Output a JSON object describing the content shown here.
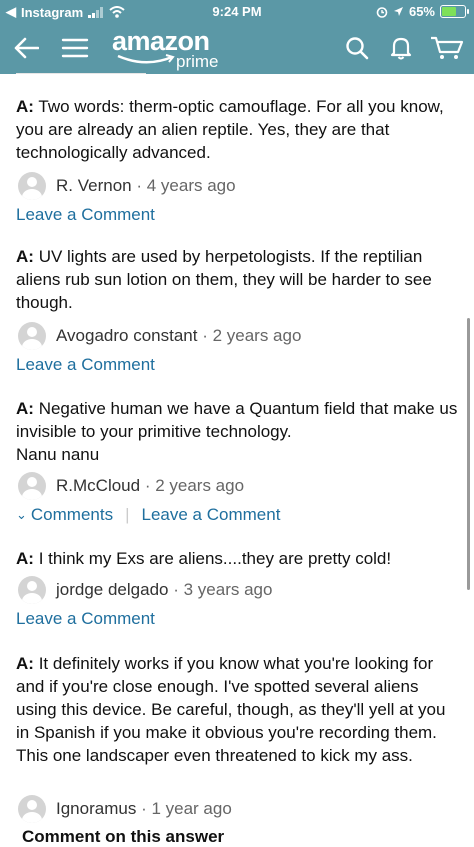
{
  "status_bar": {
    "back_app": "Instagram",
    "time": "9:24 PM",
    "battery": "65%",
    "battery_level": 0.65
  },
  "header": {
    "logo_text": "amazon",
    "logo_sub": "prime",
    "colors": {
      "bar": "#5b98a6",
      "link": "#1f6f9e"
    }
  },
  "answers": [
    {
      "prefix": "A:",
      "text": "Two words: therm-optic camouflage. For all you know, you are already an alien reptile. Yes, they are that technologically advanced.",
      "author": "R. Vernon",
      "age": "· 4 years ago",
      "leave_comment": "Leave a Comment"
    },
    {
      "prefix": "A:",
      "text": "UV lights are used by herpetologists. If the reptilian aliens rub sun lotion on them, they will be harder to see though.",
      "author": "Avogadro constant",
      "age": "· 2 years ago",
      "leave_comment": "Leave a Comment"
    },
    {
      "prefix": "A:",
      "text": "Negative human we have a Quantum field that make us invisible to your primitive technology.",
      "text2": "Nanu nanu",
      "author": "R.McCloud",
      "age": "· 2 years ago",
      "comments_link": "Comments",
      "leave_comment": "Leave a Comment"
    },
    {
      "prefix": "A:",
      "text": "I think my Exs are aliens....they are pretty cold!",
      "author": "jordge delgado",
      "age": "· 3 years ago",
      "leave_comment": "Leave a Comment"
    },
    {
      "prefix": "A:",
      "text": "It definitely works if you know what you're looking for and if you're close enough. I've spotted several aliens using this device. Be careful, though, as they'll yell at you in Spanish if you make it obvious you're recording them. This one landscaper even threatened to kick my ass.",
      "author": "Ignoramus",
      "age": "· 1 year ago",
      "comment_on_answer": "Comment on this answer"
    }
  ]
}
